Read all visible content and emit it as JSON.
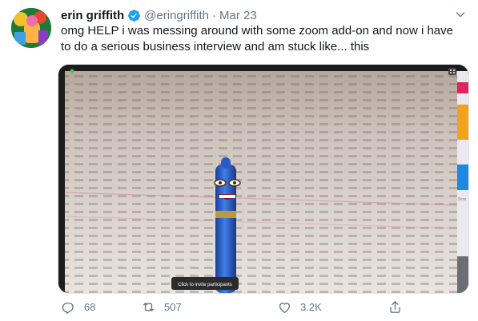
{
  "author": {
    "name": "erin griffith",
    "handle": "@eringriffith",
    "date": "Mar 23"
  },
  "tweet_text": "omg HELP i was messing around with some zoom add-on and now i have to do a serious business interview and am stuck like... this",
  "media": {
    "tooltip": "Click to invite participants",
    "side_label": "Scre"
  },
  "actions": {
    "replies": "68",
    "retweets": "507",
    "likes": "3.2K"
  },
  "colors": {
    "verified": "#1da1f2",
    "secondary_text": "#657786"
  }
}
